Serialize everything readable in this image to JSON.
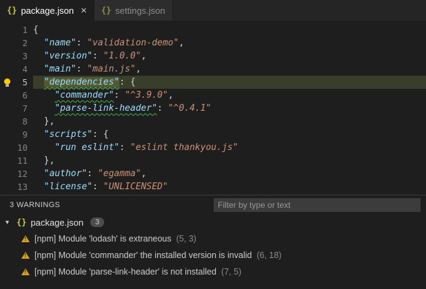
{
  "tabs": {
    "items": [
      {
        "icon": "{}",
        "label": "package.json",
        "close": "×",
        "active": true
      },
      {
        "icon": "{}",
        "label": "settings.json",
        "active": false
      }
    ]
  },
  "editor": {
    "lines": [
      {
        "num": "1",
        "segs": [
          [
            "p",
            "{"
          ]
        ]
      },
      {
        "num": "2",
        "segs": [
          [
            "p",
            "  "
          ],
          [
            "k",
            "\"name\""
          ],
          [
            "p",
            ": "
          ],
          [
            "s",
            "\"validation-demo\""
          ],
          [
            "p",
            ","
          ]
        ]
      },
      {
        "num": "3",
        "segs": [
          [
            "p",
            "  "
          ],
          [
            "k",
            "\"version\""
          ],
          [
            "p",
            ": "
          ],
          [
            "s",
            "\"1.0.0\""
          ],
          [
            "p",
            ","
          ]
        ]
      },
      {
        "num": "4",
        "segs": [
          [
            "p",
            "  "
          ],
          [
            "k",
            "\"main\""
          ],
          [
            "p",
            ": "
          ],
          [
            "s",
            "\"main.js\""
          ],
          [
            "p",
            ","
          ]
        ]
      },
      {
        "num": "5",
        "highlight": true,
        "lightbulb": true,
        "segs": [
          [
            "p",
            "  "
          ],
          [
            "khw",
            "\"dependencies\""
          ],
          [
            "p",
            ": {"
          ]
        ]
      },
      {
        "num": "6",
        "segs": [
          [
            "p",
            "    "
          ],
          [
            "kw",
            "\"commander\""
          ],
          [
            "p",
            ": "
          ],
          [
            "s",
            "\"^3.9.0\""
          ],
          [
            "p",
            ","
          ]
        ]
      },
      {
        "num": "7",
        "segs": [
          [
            "p",
            "    "
          ],
          [
            "kw",
            "\"parse-link-header\""
          ],
          [
            "p",
            ": "
          ],
          [
            "s",
            "\"^0.4.1\""
          ]
        ]
      },
      {
        "num": "8",
        "segs": [
          [
            "p",
            "  },"
          ]
        ]
      },
      {
        "num": "9",
        "segs": [
          [
            "p",
            "  "
          ],
          [
            "k",
            "\"scripts\""
          ],
          [
            "p",
            ": {"
          ]
        ]
      },
      {
        "num": "10",
        "segs": [
          [
            "p",
            "    "
          ],
          [
            "k",
            "\"run eslint\""
          ],
          [
            "p",
            ": "
          ],
          [
            "s",
            "\"eslint thankyou.js\""
          ]
        ]
      },
      {
        "num": "11",
        "segs": [
          [
            "p",
            "  },"
          ]
        ]
      },
      {
        "num": "12",
        "segs": [
          [
            "p",
            "  "
          ],
          [
            "k",
            "\"author\""
          ],
          [
            "p",
            ": "
          ],
          [
            "s",
            "\"egamma\""
          ],
          [
            "p",
            ","
          ]
        ]
      },
      {
        "num": "13",
        "segs": [
          [
            "p",
            "  "
          ],
          [
            "k",
            "\"license\""
          ],
          [
            "p",
            ": "
          ],
          [
            "s",
            "\"UNLICENSED\""
          ]
        ]
      }
    ]
  },
  "panel": {
    "header": "3 WARNINGS",
    "filter_placeholder": "Filter by type or text",
    "tree": {
      "twisty": "▾",
      "file_icon": "{}",
      "file_name": "package.json",
      "badge": "3"
    },
    "warnings": [
      {
        "message": "[npm] Module 'lodash' is extraneous",
        "pos": "(5, 3)"
      },
      {
        "message": "[npm] Module 'commander' the installed version is invalid",
        "pos": "(6, 18)"
      },
      {
        "message": "[npm] Module 'parse-link-header' is not installed",
        "pos": "(7, 5)"
      }
    ]
  },
  "colors": {
    "editor_bg": "#1e1e1e",
    "tabbar_bg": "#252526",
    "key": "#9cdcfe",
    "string": "#ce9178",
    "current_line": "#383e2a",
    "warning_icon": "#d9a712",
    "json_icon": "#cbcb41",
    "squiggle": "#41b541"
  }
}
